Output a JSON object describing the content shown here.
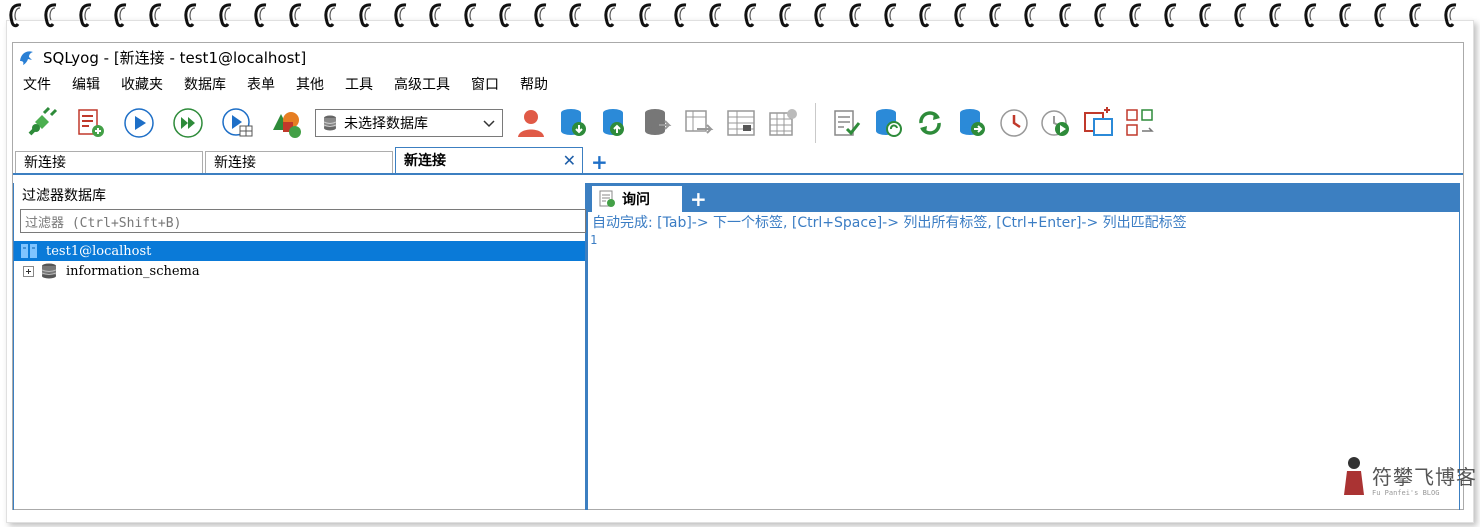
{
  "window": {
    "title": "SQLyog - [新连接 - test1@localhost]"
  },
  "menu": [
    "文件",
    "编辑",
    "收藏夹",
    "数据库",
    "表单",
    "其他",
    "工具",
    "高级工具",
    "窗口",
    "帮助"
  ],
  "toolbar": {
    "db_select_value": "未选择数据库"
  },
  "connection_tabs": [
    {
      "label": "新连接",
      "active": false
    },
    {
      "label": "新连接",
      "active": false
    },
    {
      "label": "新连接",
      "active": true
    }
  ],
  "left_pane": {
    "title": "过滤器数据库",
    "filter_placeholder": "过滤器 (Ctrl+Shift+B)",
    "tree": [
      {
        "label": "test1@localhost",
        "selected": true
      },
      {
        "label": "information_schema",
        "selected": false
      }
    ]
  },
  "query": {
    "tab_label": "询问",
    "hint": "自动完成: [Tab]-> 下一个标签, [Ctrl+Space]-> 列出所有标签, [Ctrl+Enter]-> 列出匹配标签",
    "line_number": "1"
  },
  "watermark": {
    "title": "符攀飞博客",
    "subtitle": "Fu Panfei's BLOG"
  },
  "colors": {
    "accent": "#3c7fc1",
    "selection": "#0a7ad8",
    "hint": "#3b7dc4"
  }
}
